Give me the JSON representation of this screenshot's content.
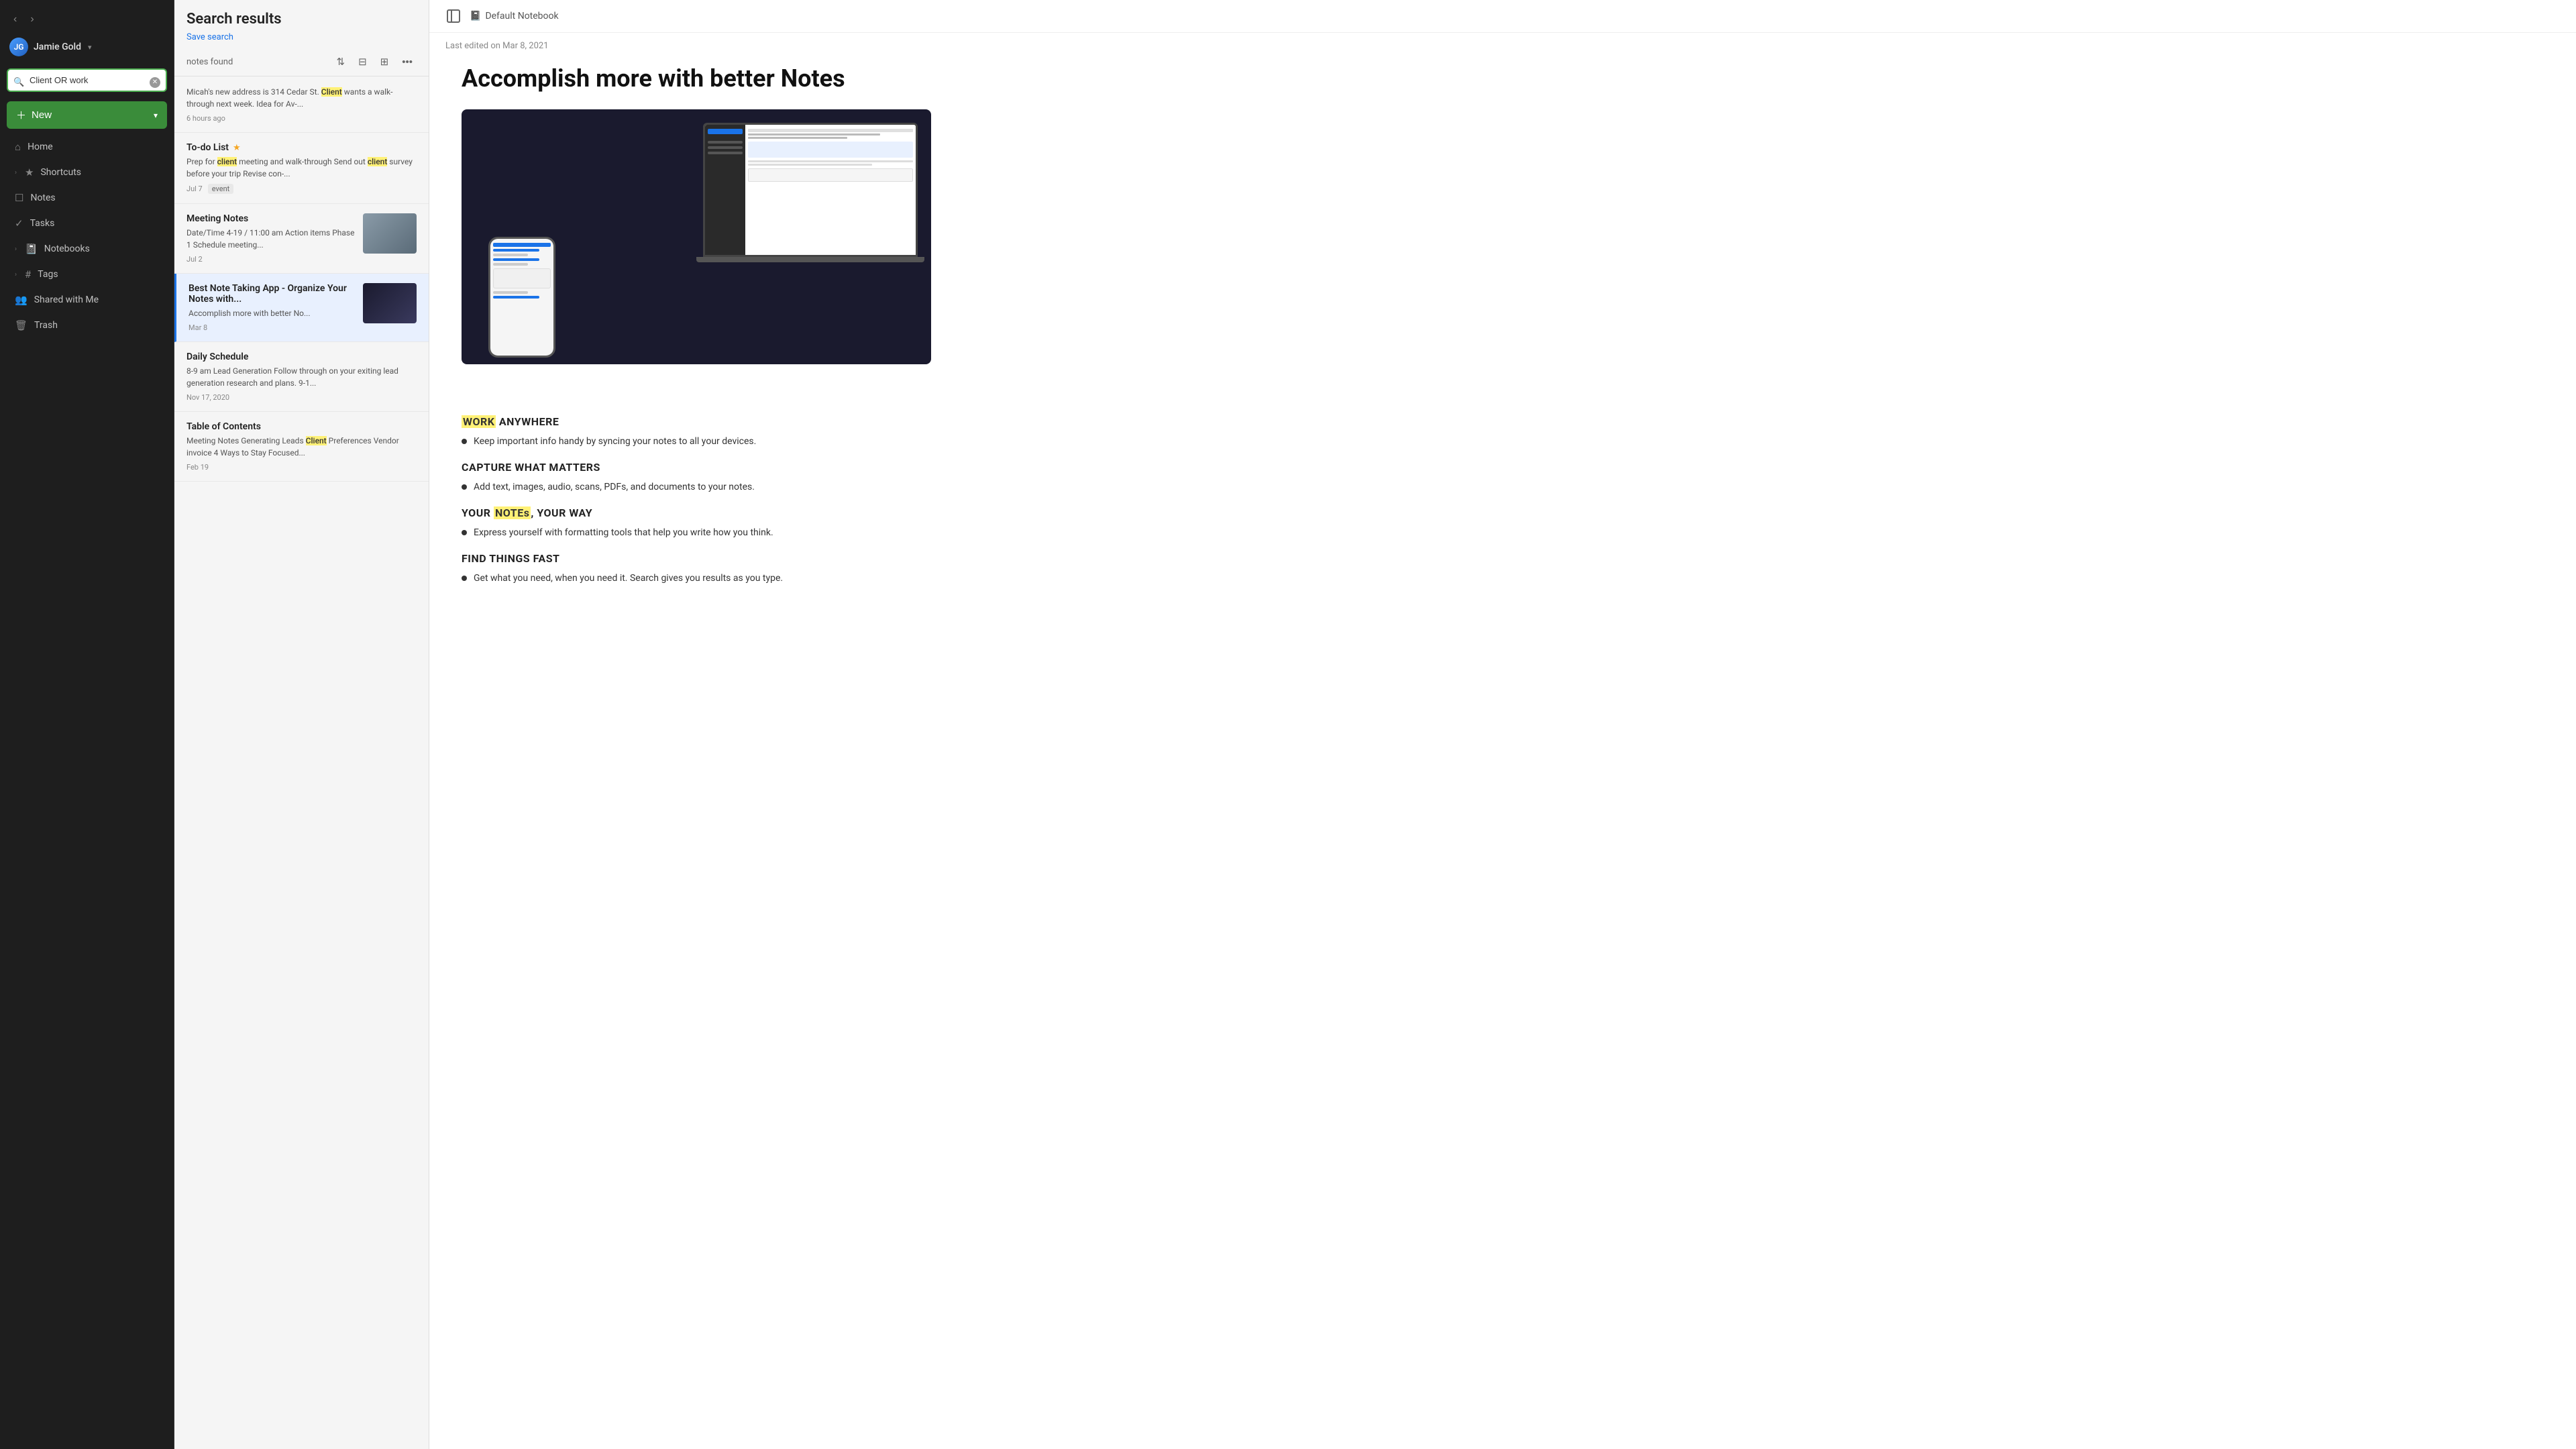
{
  "sidebar": {
    "nav": {
      "back_label": "‹",
      "forward_label": "›"
    },
    "user": {
      "name": "Jamie Gold",
      "initials": "JG",
      "chevron": "▾"
    },
    "search": {
      "value": "Client OR work",
      "placeholder": "Search"
    },
    "new_button": {
      "label": "New",
      "plus": "+",
      "chevron": "▾"
    },
    "items": [
      {
        "id": "home",
        "icon": "⌂",
        "label": "Home"
      },
      {
        "id": "shortcuts",
        "icon": "★",
        "label": "Shortcuts",
        "expand": "›"
      },
      {
        "id": "notes",
        "icon": "☐",
        "label": "Notes"
      },
      {
        "id": "tasks",
        "icon": "✓",
        "label": "Tasks"
      },
      {
        "id": "notebooks",
        "icon": "📓",
        "label": "Notebooks",
        "expand": "›"
      },
      {
        "id": "tags",
        "icon": "#",
        "label": "Tags",
        "expand": "›"
      },
      {
        "id": "shared",
        "icon": "👥",
        "label": "Shared with Me"
      },
      {
        "id": "trash",
        "icon": "🗑",
        "label": "Trash"
      }
    ]
  },
  "middle": {
    "title": "Search results",
    "save_search_label": "Save search",
    "notes_found": "notes found",
    "toolbar": {
      "sort_icon": "⇅",
      "filter_icon": "⊟",
      "view_icon": "⊞",
      "more_icon": "•••"
    },
    "notes": [
      {
        "id": "note-1",
        "title": "",
        "preview": "Micah's new address is 314 Cedar St. Client wants a walk-through next week. Idea for Av-...",
        "date": "6 hours ago",
        "has_image": false,
        "selected": false,
        "star": false,
        "tag": null,
        "highlight_words": [
          "Client"
        ]
      },
      {
        "id": "to-do-list",
        "title": "To-do List",
        "preview": "Prep for client meeting and walk-through Send out client survey before your trip Revise con-...",
        "date": "Jul 7",
        "secondary_date": "event",
        "has_image": false,
        "selected": false,
        "star": true,
        "tag": "event",
        "highlight_words": [
          "client"
        ]
      },
      {
        "id": "meeting-notes",
        "title": "Meeting Notes",
        "preview": "Date/Time 4-19 / 11:00 am Action items Phase 1 Schedule meeting...",
        "date": "Jul 2",
        "has_image": true,
        "selected": false,
        "star": false,
        "tag": null
      },
      {
        "id": "best-note-app",
        "title": "Best Note Taking App - Organize Your Notes with...",
        "preview": "Accomplish more with better No...",
        "date": "Mar 8",
        "has_image": true,
        "selected": true,
        "star": false,
        "tag": null
      },
      {
        "id": "daily-schedule",
        "title": "Daily Schedule",
        "preview": "8-9 am Lead Generation Follow through on your exiting lead generation research and plans. 9-1...",
        "date": "Nov 17, 2020",
        "has_image": false,
        "selected": false,
        "star": false,
        "tag": null
      },
      {
        "id": "table-of-contents",
        "title": "Table of Contents",
        "preview": "Meeting Notes Generating Leads Client Preferences Vendor invoice 4 Ways to Stay Focused...",
        "date": "Feb 19",
        "has_image": false,
        "selected": false,
        "star": false,
        "tag": null,
        "highlight_words": [
          "Client"
        ]
      }
    ]
  },
  "content": {
    "notebook_name": "Default Notebook",
    "last_edited": "Last edited on Mar 8, 2021",
    "title": "Accomplish more with better Notes",
    "sections": [
      {
        "heading": "WORK ANYWHERE",
        "heading_highlight": "WORK",
        "bullets": [
          "Keep important info handy by syncing your notes to all your devices."
        ]
      },
      {
        "heading": "CAPTURE WHAT MATTERS",
        "heading_highlight": null,
        "bullets": [
          "Add text, images, audio, scans, PDFs, and documents to your notes."
        ]
      },
      {
        "heading": "YOUR NOTES, YOUR WAY",
        "heading_highlight": "NOTEs",
        "bullets": [
          "Express yourself with formatting tools that help you write how you think."
        ]
      },
      {
        "heading": "FIND THINGS FAST",
        "heading_highlight": null,
        "bullets": [
          "Get what you need, when you need it. Search gives you results as you type."
        ]
      }
    ]
  }
}
